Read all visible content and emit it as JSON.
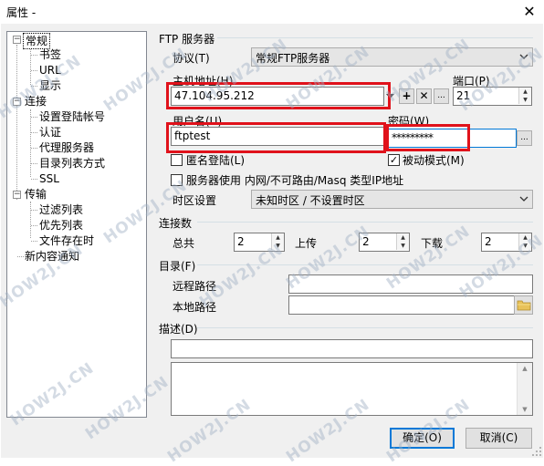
{
  "window": {
    "title": "属性 -",
    "close_glyph": "✕"
  },
  "tree": {
    "items": [
      {
        "label": "常规",
        "expanded": true,
        "selected": true
      },
      {
        "label": "书签"
      },
      {
        "label": "URL"
      },
      {
        "label": "显示"
      },
      {
        "label": "连接",
        "expanded": true
      },
      {
        "label": "设置登陆帐号"
      },
      {
        "label": "认证"
      },
      {
        "label": "代理服务器"
      },
      {
        "label": "目录列表方式"
      },
      {
        "label": "SSL"
      },
      {
        "label": "传输",
        "expanded": true
      },
      {
        "label": "过滤列表"
      },
      {
        "label": "优先列表"
      },
      {
        "label": "文件存在时"
      },
      {
        "label": "新内容通知"
      }
    ]
  },
  "ftp_server": {
    "group_label": "FTP 服务器",
    "protocol_label": "协议(T)",
    "protocol_value": "常规FTP服务器",
    "host_label": "主机地址(H)",
    "host_value": "47.104.95.212",
    "port_label": "端口(P)",
    "port_value": "21",
    "username_label": "用户名(U)",
    "username_value": "ftptest",
    "password_label": "密码(W)",
    "password_value": "*********",
    "anonymous_label": "匿名登陆(L)",
    "anonymous_checked": false,
    "passive_label": "被动模式(M)",
    "passive_checked": true,
    "masq_label": "服务器使用 内网/不可路由/Masq 类型IP地址",
    "masq_checked": false,
    "timezone_label": "时区设置",
    "timezone_value": "未知时区 / 不设置时区",
    "add_glyph": "+",
    "remove_glyph": "✕",
    "more_glyph": "..."
  },
  "connections": {
    "group_label": "连接数",
    "total_label": "总共",
    "total_value": "2",
    "upload_label": "上传",
    "upload_value": "2",
    "download_label": "下载",
    "download_value": "2"
  },
  "directory": {
    "group_label": "目录(F)",
    "remote_label": "远程路径",
    "remote_value": "",
    "local_label": "本地路径",
    "local_value": ""
  },
  "description": {
    "group_label": "描述(D)",
    "line_value": "",
    "body_value": ""
  },
  "footer": {
    "ok_label": "确定(O)",
    "cancel_label": "取消(C)"
  },
  "watermark": "HOW2J.CN",
  "colors": {
    "highlight_box": "#e0121b",
    "default_button_border": "#0078d7"
  }
}
